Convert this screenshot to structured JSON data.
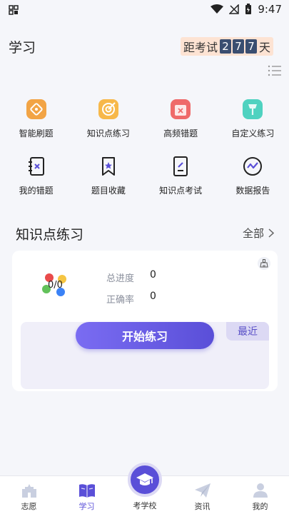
{
  "status": {
    "time": "9:47"
  },
  "header": {
    "title": "学习",
    "countdown": {
      "prefix": "距考试",
      "digits": [
        "2",
        "7",
        "7"
      ],
      "suffix": "天"
    }
  },
  "grid": [
    {
      "label": "智能刷题",
      "icon": "smart-practice-icon"
    },
    {
      "label": "知识点练习",
      "icon": "knowledge-practice-icon"
    },
    {
      "label": "高频错题",
      "icon": "frequent-mistakes-icon"
    },
    {
      "label": "自定义练习",
      "icon": "custom-practice-icon"
    },
    {
      "label": "我的错题",
      "icon": "my-mistakes-icon"
    },
    {
      "label": "题目收藏",
      "icon": "favorites-icon"
    },
    {
      "label": "知识点考试",
      "icon": "knowledge-exam-icon"
    },
    {
      "label": "数据报告",
      "icon": "data-report-icon"
    }
  ],
  "section": {
    "title": "知识点练习",
    "all_label": "全部"
  },
  "card": {
    "ratio": "0/0",
    "progress_label": "总进度",
    "progress_value": "0",
    "accuracy_label": "正确率",
    "accuracy_value": "0",
    "recent_label": "最近",
    "start_label": "开始练习"
  },
  "tabs": [
    {
      "label": "志愿",
      "icon": "castle-icon"
    },
    {
      "label": "学习",
      "icon": "book-icon"
    },
    {
      "label": "考学校",
      "icon": "graduation-cap-icon"
    },
    {
      "label": "资讯",
      "icon": "paper-plane-icon"
    },
    {
      "label": "我的",
      "icon": "user-icon"
    }
  ],
  "colors": {
    "accent": "#5a4fd8",
    "countdown_bg": "#fde3d3",
    "digit_bg": "#3a4e70"
  }
}
